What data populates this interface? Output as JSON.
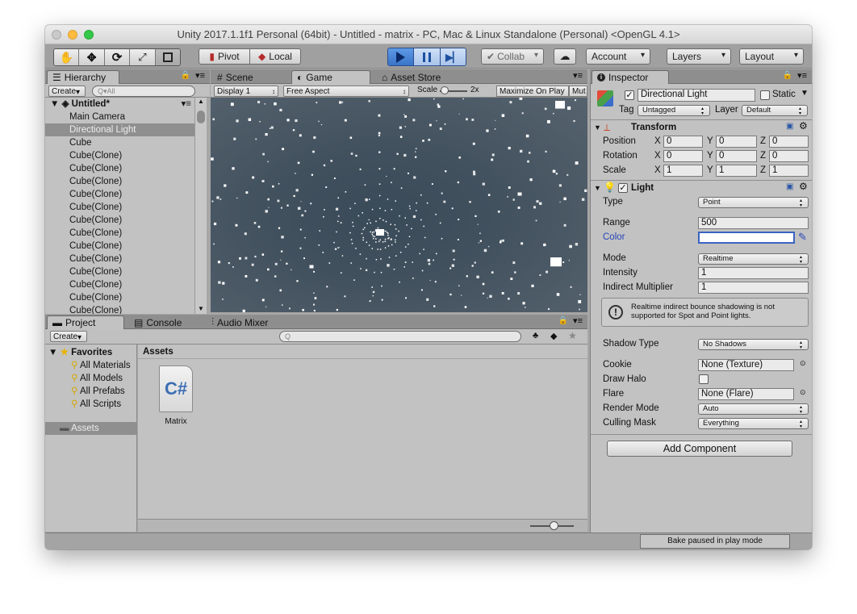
{
  "window": {
    "title": "Unity 2017.1.1f1 Personal (64bit) - Untitled - matrix - PC, Mac & Linux Standalone (Personal) <OpenGL 4.1>"
  },
  "toolbar": {
    "pivot": "Pivot",
    "local": "Local",
    "collab": "Collab",
    "account": "Account",
    "layers": "Layers",
    "layout": "Layout"
  },
  "hierarchy": {
    "tab": "Hierarchy",
    "create": "Create",
    "search_placeholder": "All",
    "scene": "Untitled*",
    "items": [
      "Main Camera",
      "Directional Light",
      "Cube",
      "Cube(Clone)",
      "Cube(Clone)",
      "Cube(Clone)",
      "Cube(Clone)",
      "Cube(Clone)",
      "Cube(Clone)",
      "Cube(Clone)",
      "Cube(Clone)",
      "Cube(Clone)",
      "Cube(Clone)",
      "Cube(Clone)",
      "Cube(Clone)"
    ]
  },
  "views": {
    "scene_tab": "Scene",
    "game_tab": "Game",
    "store_tab": "Asset Store",
    "display": "Display 1",
    "aspect": "Free Aspect",
    "scale_label": "Scale",
    "scale_value": "2x",
    "maximize": "Maximize On Play",
    "mute": "Mut"
  },
  "project": {
    "project_tab": "Project",
    "console_tab": "Console",
    "mixer_tab": "Audio Mixer",
    "create": "Create",
    "favorites": "Favorites",
    "fav_items": [
      "All Materials",
      "All Models",
      "All Prefabs",
      "All Scripts"
    ],
    "assets_folder": "Assets",
    "breadcrumb": "Assets",
    "files": [
      {
        "name": "Matrix",
        "glyph": "C#"
      }
    ]
  },
  "inspector": {
    "tab": "Inspector",
    "object_name": "Directional Light",
    "static": "Static",
    "tag_label": "Tag",
    "tag_value": "Untagged",
    "layer_label": "Layer",
    "layer_value": "Default",
    "transform": {
      "title": "Transform",
      "rows": [
        {
          "label": "Position",
          "x": "0",
          "y": "0",
          "z": "0"
        },
        {
          "label": "Rotation",
          "x": "0",
          "y": "0",
          "z": "0"
        },
        {
          "label": "Scale",
          "x": "1",
          "y": "1",
          "z": "1"
        }
      ]
    },
    "light": {
      "title": "Light",
      "type_label": "Type",
      "type_value": "Point",
      "range_label": "Range",
      "range_value": "500",
      "color_label": "Color",
      "color_value": "#ffffff",
      "mode_label": "Mode",
      "mode_value": "Realtime",
      "intensity_label": "Intensity",
      "intensity_value": "1",
      "indirect_label": "Indirect Multiplier",
      "indirect_value": "1",
      "warning": "Realtime indirect bounce shadowing is not supported for Spot and Point lights.",
      "shadow_label": "Shadow Type",
      "shadow_value": "No Shadows",
      "cookie_label": "Cookie",
      "cookie_value": "None (Texture)",
      "halo_label": "Draw Halo",
      "flare_label": "Flare",
      "flare_value": "None (Flare)",
      "render_label": "Render Mode",
      "render_value": "Auto",
      "culling_label": "Culling Mask",
      "culling_value": "Everything"
    },
    "add_component": "Add Component"
  },
  "status": {
    "bake": "Bake paused in play mode"
  },
  "colors": {
    "accent": "#3a74c8",
    "selection": "#8f8f8f",
    "panel": "#c2c2c2"
  }
}
